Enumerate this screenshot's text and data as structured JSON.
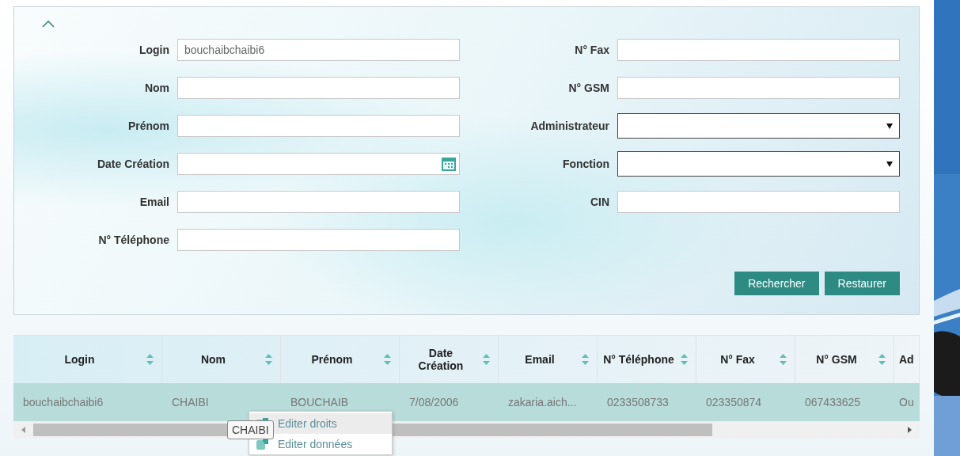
{
  "form": {
    "left_fields": [
      {
        "label": "Login",
        "kind": "text",
        "value": "bouchaibchaibi6"
      },
      {
        "label": "Nom",
        "kind": "text"
      },
      {
        "label": "Prénom",
        "kind": "text"
      },
      {
        "label": "Date Création",
        "kind": "date"
      },
      {
        "label": "Email",
        "kind": "text"
      },
      {
        "label": "N° Téléphone",
        "kind": "text"
      }
    ],
    "right_fields": [
      {
        "label": "N° Fax",
        "kind": "text"
      },
      {
        "label": "N° GSM",
        "kind": "text"
      },
      {
        "label": "Administrateur",
        "kind": "select"
      },
      {
        "label": "Fonction",
        "kind": "select"
      },
      {
        "label": "CIN",
        "kind": "text"
      }
    ],
    "buttons": [
      "Rechercher",
      "Restaurer"
    ]
  },
  "table": {
    "columns": [
      {
        "label": "Login",
        "sortable": true
      },
      {
        "label": "Nom",
        "sortable": true
      },
      {
        "label": "Prénom",
        "sortable": true
      },
      {
        "label": "Date Création",
        "sortable": true
      },
      {
        "label": "Email",
        "sortable": true
      },
      {
        "label": "N° Téléphone",
        "sortable": true
      },
      {
        "label": "N° Fax",
        "sortable": true
      },
      {
        "label": "N° GSM",
        "sortable": true
      },
      {
        "label": "Ad",
        "sortable": false
      }
    ],
    "rows": [
      {
        "selected": true,
        "cells": [
          "bouchaibchaibi6",
          "CHAIBI",
          "BOUCHAIB",
          "7/08/2006",
          "zakaria.aich...",
          "0233508733",
          "023350874",
          "067433625",
          "Ou"
        ]
      }
    ]
  },
  "context_menu": {
    "items": [
      {
        "label": "Editer droits",
        "selected": true
      },
      {
        "label": "Editer données",
        "selected": false
      }
    ]
  },
  "tooltip": "CHAIBI"
}
